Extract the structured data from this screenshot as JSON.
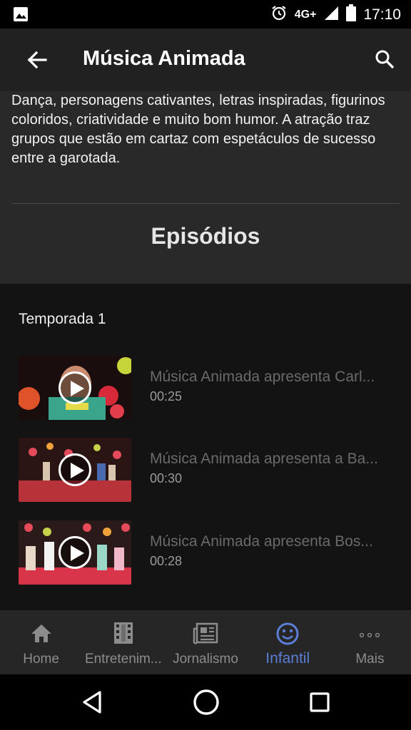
{
  "status_bar": {
    "left_icon": "image-icon",
    "time": "17:10",
    "network": "4G+",
    "icons": [
      "alarm-icon",
      "signal-icon",
      "battery-icon"
    ]
  },
  "app_bar": {
    "title": "Música Animada",
    "back_icon": "arrow-back-icon",
    "search_icon": "search-icon"
  },
  "info": {
    "description": "Dança, personagens cativantes, letras inspiradas, figurinos coloridos, criatividade e muito bom humor. A atração traz grupos que estão em cartaz com espetáculos de sucesso entre a garotada.",
    "episodes_heading": "Episódios"
  },
  "season": {
    "label": "Temporada 1"
  },
  "episodes": [
    {
      "title": "Música Animada apresenta Carl...",
      "duration": "00:25"
    },
    {
      "title": "Música Animada apresenta a Ba...",
      "duration": "00:30"
    },
    {
      "title": "Música Animada apresenta Bos...",
      "duration": "00:28"
    }
  ],
  "bottom_nav": {
    "items": [
      {
        "label": "Home",
        "icon": "home-icon"
      },
      {
        "label": "Entretenim...",
        "icon": "film-icon"
      },
      {
        "label": "Jornalismo",
        "icon": "newspaper-icon"
      },
      {
        "label": "Infantil",
        "icon": "smiley-icon"
      },
      {
        "label": "Mais",
        "icon": "more-icon"
      }
    ],
    "active": "Infantil"
  },
  "colors": {
    "accent": "#5c7ed6",
    "app_bar": "#212121",
    "info_bg": "#292929",
    "list_bg": "#131313"
  }
}
